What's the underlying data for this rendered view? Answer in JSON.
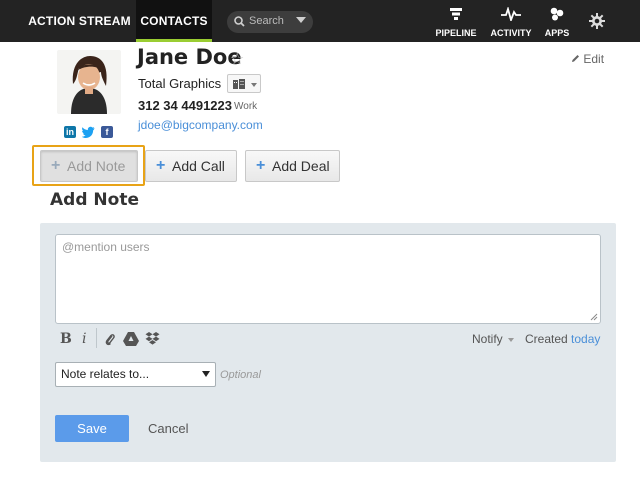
{
  "topbar": {
    "tabs": [
      {
        "label": "ACTION STREAM"
      },
      {
        "label": "CONTACTS"
      }
    ],
    "search": {
      "placeholder": "Search"
    },
    "items": [
      {
        "label": "PIPELINE",
        "icon": "pipeline-icon"
      },
      {
        "label": "ACTIVITY",
        "icon": "activity-icon"
      },
      {
        "label": "APPS",
        "icon": "apps-icon"
      }
    ],
    "settings_icon": "gear-icon",
    "accent_color": "#9acd32"
  },
  "contact": {
    "name": "Jane Doe",
    "company": "Total Graphics",
    "phone": "312 34 4491223",
    "phone_type": "Work",
    "email": "jdoe@bigcompany.com",
    "edit_label": "Edit",
    "social": [
      "linkedin-icon",
      "twitter-icon",
      "facebook-icon"
    ]
  },
  "actions": {
    "add_note": "Add Note",
    "add_call": "Add Call",
    "add_deal": "Add Deal"
  },
  "note_form": {
    "title": "Add Note",
    "placeholder": "@mention users",
    "bold": "B",
    "italic": "i",
    "notify_label": "Notify",
    "created_label": "Created",
    "created_value": "today",
    "relates_select": "Note relates to...",
    "optional_label": "Optional",
    "save_label": "Save",
    "cancel_label": "Cancel"
  }
}
